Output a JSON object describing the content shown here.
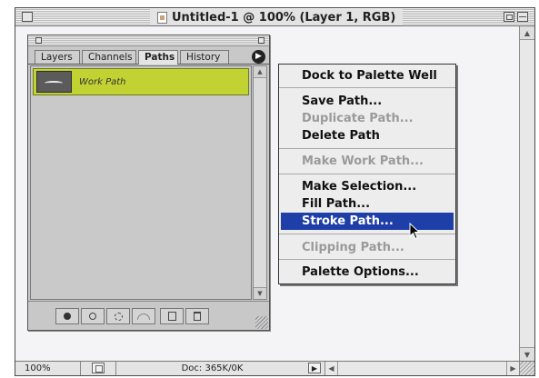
{
  "window": {
    "title": "Untitled-1 @ 100% (Layer 1, RGB)",
    "zoom": "100%",
    "doc_size": "Doc: 365K/0K"
  },
  "palette": {
    "tabs": [
      {
        "label": "Layers"
      },
      {
        "label": "Channels"
      },
      {
        "label": "Paths"
      },
      {
        "label": "History"
      }
    ],
    "active_tab": "Paths",
    "paths": [
      {
        "name": "Work Path"
      }
    ]
  },
  "menu": {
    "items": [
      {
        "label": "Dock to Palette Well",
        "enabled": true
      },
      {
        "label": "Save Path...",
        "enabled": true
      },
      {
        "label": "Duplicate Path...",
        "enabled": false
      },
      {
        "label": "Delete Path",
        "enabled": true
      },
      {
        "label": "Make Work Path...",
        "enabled": false
      },
      {
        "label": "Make Selection...",
        "enabled": true
      },
      {
        "label": "Fill Path...",
        "enabled": true
      },
      {
        "label": "Stroke Path...",
        "enabled": true,
        "highlighted": true
      },
      {
        "label": "Clipping Path...",
        "enabled": false
      },
      {
        "label": "Palette Options...",
        "enabled": true
      }
    ]
  },
  "colors": {
    "selected_path_row": "#c3d233",
    "menu_highlight": "#1f3fa8",
    "menu_disabled": "#9a9a9a"
  },
  "icons": {
    "footer": [
      "fill-path-icon",
      "stroke-path-icon",
      "load-selection-icon",
      "make-work-path-icon",
      "new-path-icon",
      "trash-icon"
    ]
  }
}
